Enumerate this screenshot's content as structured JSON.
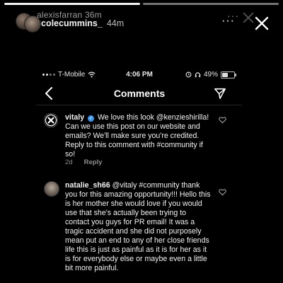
{
  "story": {
    "ghost_username": "alexisfarran",
    "ghost_time": "36m",
    "username": "colecummins_",
    "time": "44m",
    "more_label": "···",
    "progress_segments": [
      {
        "state": "active"
      },
      {
        "state": "inactive"
      }
    ]
  },
  "phone": {
    "status": {
      "carrier": "T-Mobile",
      "time": "4:06 PM",
      "battery": "49%",
      "battery_level": 0.49
    },
    "nav": {
      "title": "Comments"
    },
    "comments": [
      {
        "username": "vitaly",
        "verified": true,
        "text": "We love this look @kenzieshirilla! Can we use this post on our website and emails? We'll make sure you're credited. Reply to this comment with #community if so!",
        "age": "2d",
        "reply_label": "Reply"
      },
      {
        "username": "natalie_sh66",
        "verified": false,
        "text": "@vitaly #community thank you for this amazing opportunity!!! Hello this is her mother she would love if you would use that she's actually been trying to contact you guys for PR email! It was a tragic accident and she did not purposely mean put an end to any of her close friends life this is just as painful as it is for her as it is for everybody else or maybe even a little bit more painful."
      }
    ]
  },
  "colors": {
    "background": "#000000",
    "text": "#ffffff",
    "muted": "#8e8e8e",
    "verified": "#3897f0"
  },
  "icons": {
    "close": "close-icon",
    "back": "chevron-left-icon",
    "send": "send-icon",
    "wifi": "wifi-icon",
    "heart": "heart-icon",
    "headphones": "headphones-icon",
    "alarm": "alarm-icon",
    "battery": "battery-icon"
  }
}
